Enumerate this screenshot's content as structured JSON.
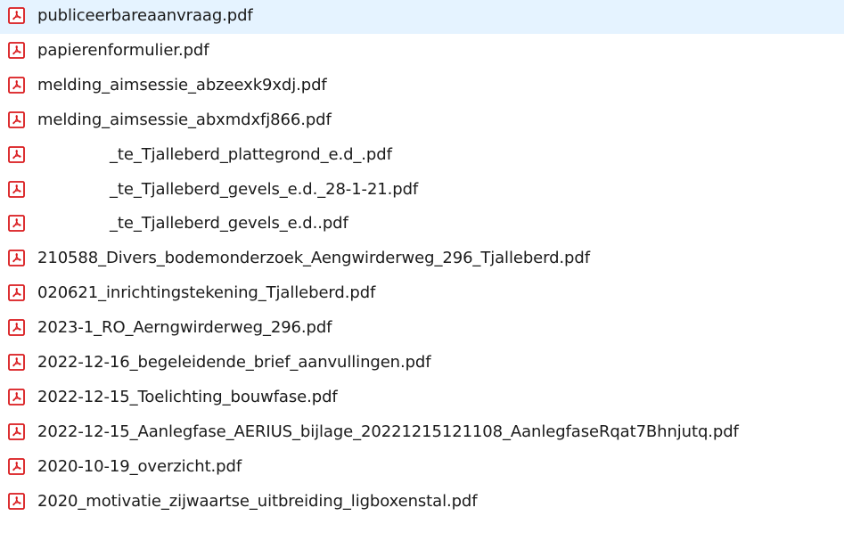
{
  "files": [
    {
      "name": "publiceerbareaanvraag.pdf",
      "icon": "pdf-file-icon",
      "redacted": false
    },
    {
      "name": "papierenformulier.pdf",
      "icon": "pdf-file-icon",
      "redacted": false
    },
    {
      "name": "melding_aimsessie_abzeexk9xdj.pdf",
      "icon": "pdf-file-icon",
      "redacted": false
    },
    {
      "name": "melding_aimsessie_abxmdxfj866.pdf",
      "icon": "pdf-file-icon",
      "redacted": false
    },
    {
      "name": "_te_Tjalleberd_plattegrond_e.d_.pdf",
      "icon": "pdf-file-icon",
      "redacted": true
    },
    {
      "name": "_te_Tjalleberd_gevels_e.d._28-1-21.pdf",
      "icon": "pdf-file-icon",
      "redacted": true
    },
    {
      "name": "_te_Tjalleberd_gevels_e.d..pdf",
      "icon": "pdf-file-icon",
      "redacted": true
    },
    {
      "name": "210588_Divers_bodemonderzoek_Aengwirderweg_296_Tjalleberd.pdf",
      "icon": "pdf-file-icon",
      "redacted": false
    },
    {
      "name": "020621_inrichtingstekening_Tjalleberd.pdf",
      "icon": "pdf-file-icon",
      "redacted": false
    },
    {
      "name": "2023-1_RO_Aerngwirderweg_296.pdf",
      "icon": "pdf-file-icon",
      "redacted": false
    },
    {
      "name": "2022-12-16_begeleidende_brief_aanvullingen.pdf",
      "icon": "pdf-file-icon",
      "redacted": false
    },
    {
      "name": "2022-12-15_Toelichting_bouwfase.pdf",
      "icon": "pdf-file-icon",
      "redacted": false
    },
    {
      "name": "2022-12-15_Aanlegfase_AERIUS_bijlage_20221215121108_AanlegfaseRqat7Bhnjutq.pdf",
      "icon": "pdf-file-icon",
      "redacted": false
    },
    {
      "name": "2020-10-19_overzicht.pdf",
      "icon": "pdf-file-icon",
      "redacted": false
    },
    {
      "name": "2020_motivatie_zijwaartse_uitbreiding_ligboxenstal.pdf",
      "icon": "pdf-file-icon",
      "redacted": false
    }
  ],
  "colors": {
    "icon_red": "#d9191c",
    "icon_bg": "#ffffff",
    "text": "#1a1a1a"
  }
}
